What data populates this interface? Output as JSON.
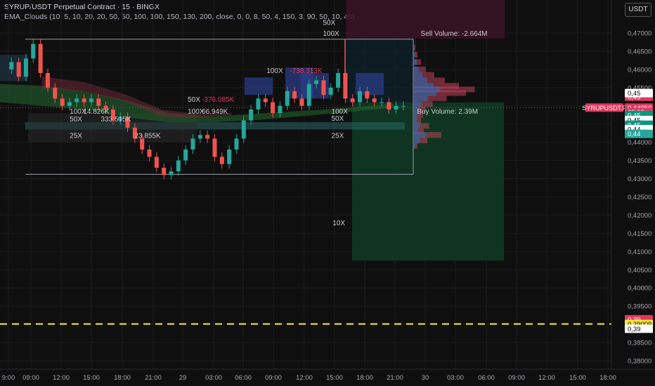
{
  "header": {
    "title": "SYRUP/USDT Perpetual Contract · 15 · BINGX",
    "indicator": "EMA_Clouds (10, 5, 10, 20, 20, 50, 50, 100, 100, 150, 130, 200, close, 0, 0, 8, 50, 4, 150, 3, 90, 50, 10, 40)",
    "currency_button": "USDT"
  },
  "colors": {
    "background": "#0f0f0f",
    "up": "#26a69a",
    "down": "#ef5350",
    "sell": "#e0375f",
    "buy": "#089981",
    "highlight": "#ffeb3b"
  },
  "chart_data": {
    "type": "candlestick",
    "symbol": "SYRUPUSDT.P",
    "ylim": [
      0.38,
      0.475
    ],
    "y_ticks": [
      "0,47000",
      "0,46500",
      "0,46000",
      "0,45500",
      "0,45000",
      "0,44500",
      "0,44000",
      "0,43500",
      "0,43000",
      "0,42500",
      "0,42000",
      "0,41500",
      "0,41000",
      "0,40500",
      "0,40000",
      "0,39500",
      "0,39000",
      "0,38500",
      "0,38000"
    ],
    "x_ticks": [
      "9:00",
      "09:00",
      "12:00",
      "15:00",
      "18:00",
      "21:00",
      "29",
      "03:00",
      "06:00",
      "09:00",
      "12:00",
      "15:00",
      "18:00",
      "21:00",
      "30",
      "03:00",
      "06:00",
      "09:00",
      "12:00",
      "15:00",
      "18:00"
    ],
    "close_path": [
      0.46,
      0.462,
      0.458,
      0.463,
      0.467,
      0.459,
      0.455,
      0.452,
      0.45,
      0.451,
      0.452,
      0.451,
      0.452,
      0.45,
      0.449,
      0.446,
      0.447,
      0.444,
      0.441,
      0.438,
      0.436,
      0.433,
      0.431,
      0.432,
      0.435,
      0.438,
      0.441,
      0.442,
      0.441,
      0.436,
      0.434,
      0.438,
      0.441,
      0.446,
      0.449,
      0.452,
      0.451,
      0.448,
      0.45,
      0.454,
      0.452,
      0.45,
      0.456,
      0.457,
      0.453,
      0.455,
      0.459,
      0.452,
      0.451,
      0.454,
      0.452,
      0.451,
      0.451,
      0.449,
      0.45,
      0.45
    ],
    "price_labels": [
      {
        "text": "0,45",
        "bg": "#e0375f",
        "fg": "#ffffff",
        "value": 0.4525
      },
      {
        "text": "0,45",
        "bg": "#ffffff",
        "fg": "#000000",
        "value": 0.4535
      },
      {
        "text": "SYRUPUSDT.P",
        "bg": "#e0375f",
        "fg": "#ffffff",
        "value": 0.4495,
        "left": true
      },
      {
        "text": "0,44950",
        "bg": "#e0375f",
        "fg": "#ffffff",
        "value": 0.4495
      },
      {
        "text": "08:08",
        "bg": "#e0375f",
        "fg": "#ffffff",
        "value": 0.4483
      },
      {
        "text": "0,45",
        "bg": "#089981",
        "fg": "#ffffff",
        "value": 0.4475
      },
      {
        "text": "0,45",
        "bg": "#ffffff",
        "fg": "#000000",
        "value": 0.4461
      },
      {
        "text": "0,45",
        "bg": "#089981",
        "fg": "#ffffff",
        "value": 0.4448
      },
      {
        "text": "0,44",
        "bg": "#ffffff",
        "fg": "#000000",
        "value": 0.4436
      },
      {
        "text": "0,44",
        "bg": "#26a69a",
        "fg": "#ffffff",
        "value": 0.4423
      },
      {
        "text": "0,39",
        "bg": "#e0375f",
        "fg": "#ffffff",
        "value": 0.3914
      },
      {
        "text": "0,39009",
        "bg": "#ffeb3b",
        "fg": "#000000",
        "value": 0.3901
      },
      {
        "text": "0,39",
        "bg": "#ffffff",
        "fg": "#000000",
        "value": 0.3888
      }
    ],
    "annotations": [
      {
        "text": "50X",
        "value": 0.473,
        "xr": 0.528
      },
      {
        "text": "100X",
        "value": 0.47,
        "xr": 0.528
      },
      {
        "text": "Sell Volume: -2.664M",
        "value": 0.47,
        "xr": 0.688
      },
      {
        "text": "100X",
        "value": 0.4598,
        "xr": 0.436
      },
      {
        "text": "-738.313K",
        "value": 0.4598,
        "xr": 0.474,
        "color": "#e0375f"
      },
      {
        "text": "50X",
        "value": 0.4519,
        "xr": 0.307
      },
      {
        "text": "-376.085K",
        "value": 0.4519,
        "xr": 0.33,
        "color": "#e0375f"
      },
      {
        "text": "100X",
        "value": 0.4486,
        "xr": 0.114
      },
      {
        "text": "14.826K",
        "value": 0.4486,
        "xr": 0.136
      },
      {
        "text": "100X",
        "value": 0.4486,
        "xr": 0.307
      },
      {
        "text": "66.949K",
        "value": 0.4486,
        "xr": 0.33
      },
      {
        "text": "100X",
        "value": 0.4486,
        "xr": 0.542
      },
      {
        "text": "Buy Volume: 2.39M",
        "value": 0.4486,
        "xr": 0.682
      },
      {
        "text": "50X",
        "value": 0.4465,
        "xr": 0.114
      },
      {
        "text": "333.515K",
        "value": 0.4465,
        "xr": 0.165
      },
      {
        "text": "50X",
        "value": 0.4467,
        "xr": 0.542
      },
      {
        "text": "25X",
        "value": 0.442,
        "xr": 0.114
      },
      {
        "text": "23.855K",
        "value": 0.442,
        "xr": 0.22
      },
      {
        "text": "25X",
        "value": 0.442,
        "xr": 0.542
      },
      {
        "text": "10X",
        "value": 0.418,
        "xr": 0.544
      }
    ],
    "dashed_level": 0.3901
  }
}
